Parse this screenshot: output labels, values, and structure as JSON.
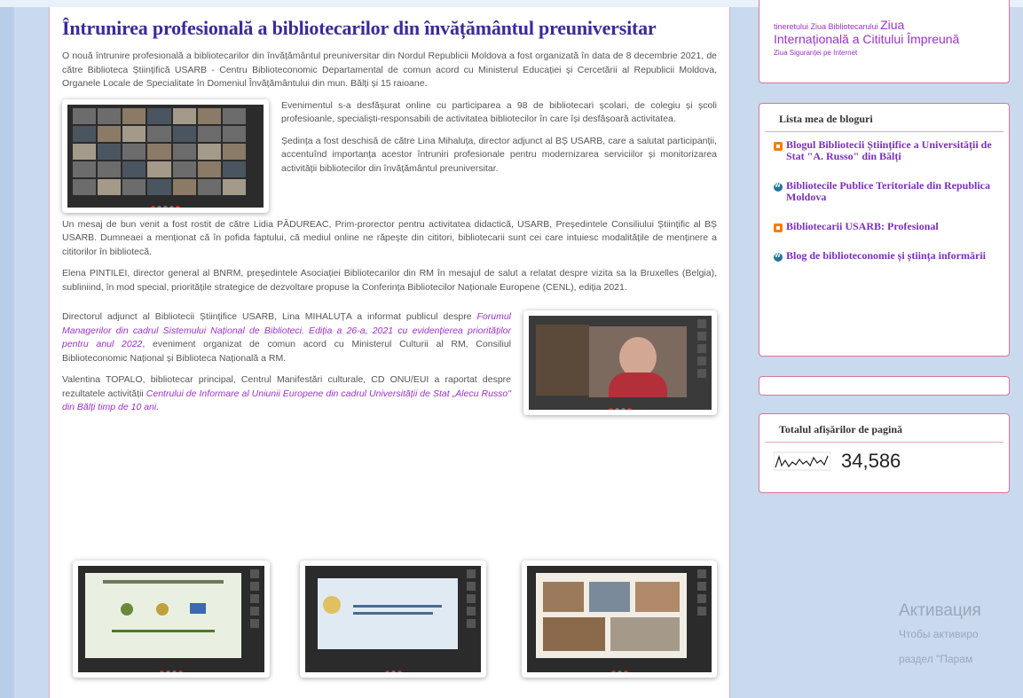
{
  "post": {
    "title": "Întrunirea profesională a bibliotecarilor din învățământul preuniversitar",
    "p1": "O nouă întrunire profesională a bibliotecarilor din învățământul preuniversitar din Nordul Republicii Moldova a fost organizată în data de 8 decembrie 2021, de către Biblioteca Științifică USARB - Centru Biblioteconomic Departamental de comun acord cu Ministerul Educației și Cercetării al Republicii Moldova, Organele Locale de Specialitate în Domeniul Învățământului din mun. Bălți și 15 raioane.",
    "p2": "Evenimentul s-a desfășurat online cu participarea a 98 de bibliotecari școlari, de colegiu și școli profesioanle, specialiști-responsabili de activitatea bibliotecilor în care își desfășoară activitatea.",
    "p3": "Ședința a fost deschisă de către Lina Mihaluța, director adjunct al BȘ USARB, care a salutat participanții, accentuînd importanța acestor întruniri profesionale pentru modernizarea serviciilor și monitorizarea activității bibliotecilor din învățământul preuniversitar.",
    "p4": "Un mesaj de bun venit a fost rostit de către Lidia PĂDUREAC, Prim-prorector pentru activitatea didactică, USARB, Președintele Consiliului Științific al BȘ USARB. Dumneaei a menționat că în pofida faptului, că mediul online ne răpește din cititori, bibliotecarii sunt cei care intuiesc modalitățile de menținere a cititorilor în bibliotecă.",
    "p5": "Elena PINTILEI, director general al BNRM, președintele Asociației Bibliotecarilor din RM în mesajul de salut a relatat despre vizita sa la Bruxelles (Belgia), subliniind, în mod special, prioritățile strategice de dezvoltare propuse la Conferința Bibliotecilor Naționale Europene (CENL), ediția 2021.",
    "p6_a": "Directorul adjunct al Bibliotecii Științifice USARB, Lina MIHALUȚA a informat publicul despre ",
    "p6_link": "Forumul Managerilor din cadrul Sistemului Național de Biblioteci. Ediția a 26-a, 2021 cu evidențierea priorităților pentru anul 2022",
    "p6_b": ", eveniment organizat de comun acord cu Ministerul Culturii al RM, Consiliul Biblioteconomic Național și Biblioteca Națională a RM.",
    "p7_a": "Valentina TOPALO, bibliotecar principal, Centrul Manifestări culturale, CD ONU/EUI a raportat despre rezultatele activității ",
    "p7_link": "Centrului de Informare al Uniunii Europene din cadrul Universității de Stat „Alecu Russo\" din Bălți timp de 10 ani."
  },
  "sidebar": {
    "tags": {
      "line1": "tineretului  Ziua  Bibliotecarului",
      "big1": "Ziua",
      "big2": "Internațională a Cititului Împreună",
      "small": "Ziua Siguranței pe Internet"
    },
    "blogs": {
      "title": "Lista mea de bloguri",
      "items": [
        {
          "label": "Blogul Bibliotecii Științifice a Universității de Stat \"A. Russo\" din Bălți",
          "icon": "blogger-icon"
        },
        {
          "label": "Bibliotecile Publice Teritoriale din Republica Moldova",
          "icon": "wordpress-icon"
        },
        {
          "label": "Bibliotecarii USARB: Profesional",
          "icon": "blogger-icon"
        },
        {
          "label": "Blog de biblioteconomie și știința informării",
          "icon": "wordpress-icon"
        }
      ]
    },
    "stats": {
      "title": "Totalul afișărilor de pagină",
      "count": "34,586"
    }
  },
  "watermark": {
    "title": "Активация",
    "line1": "Чтобы активиро",
    "line2": "раздел \"Парам"
  }
}
